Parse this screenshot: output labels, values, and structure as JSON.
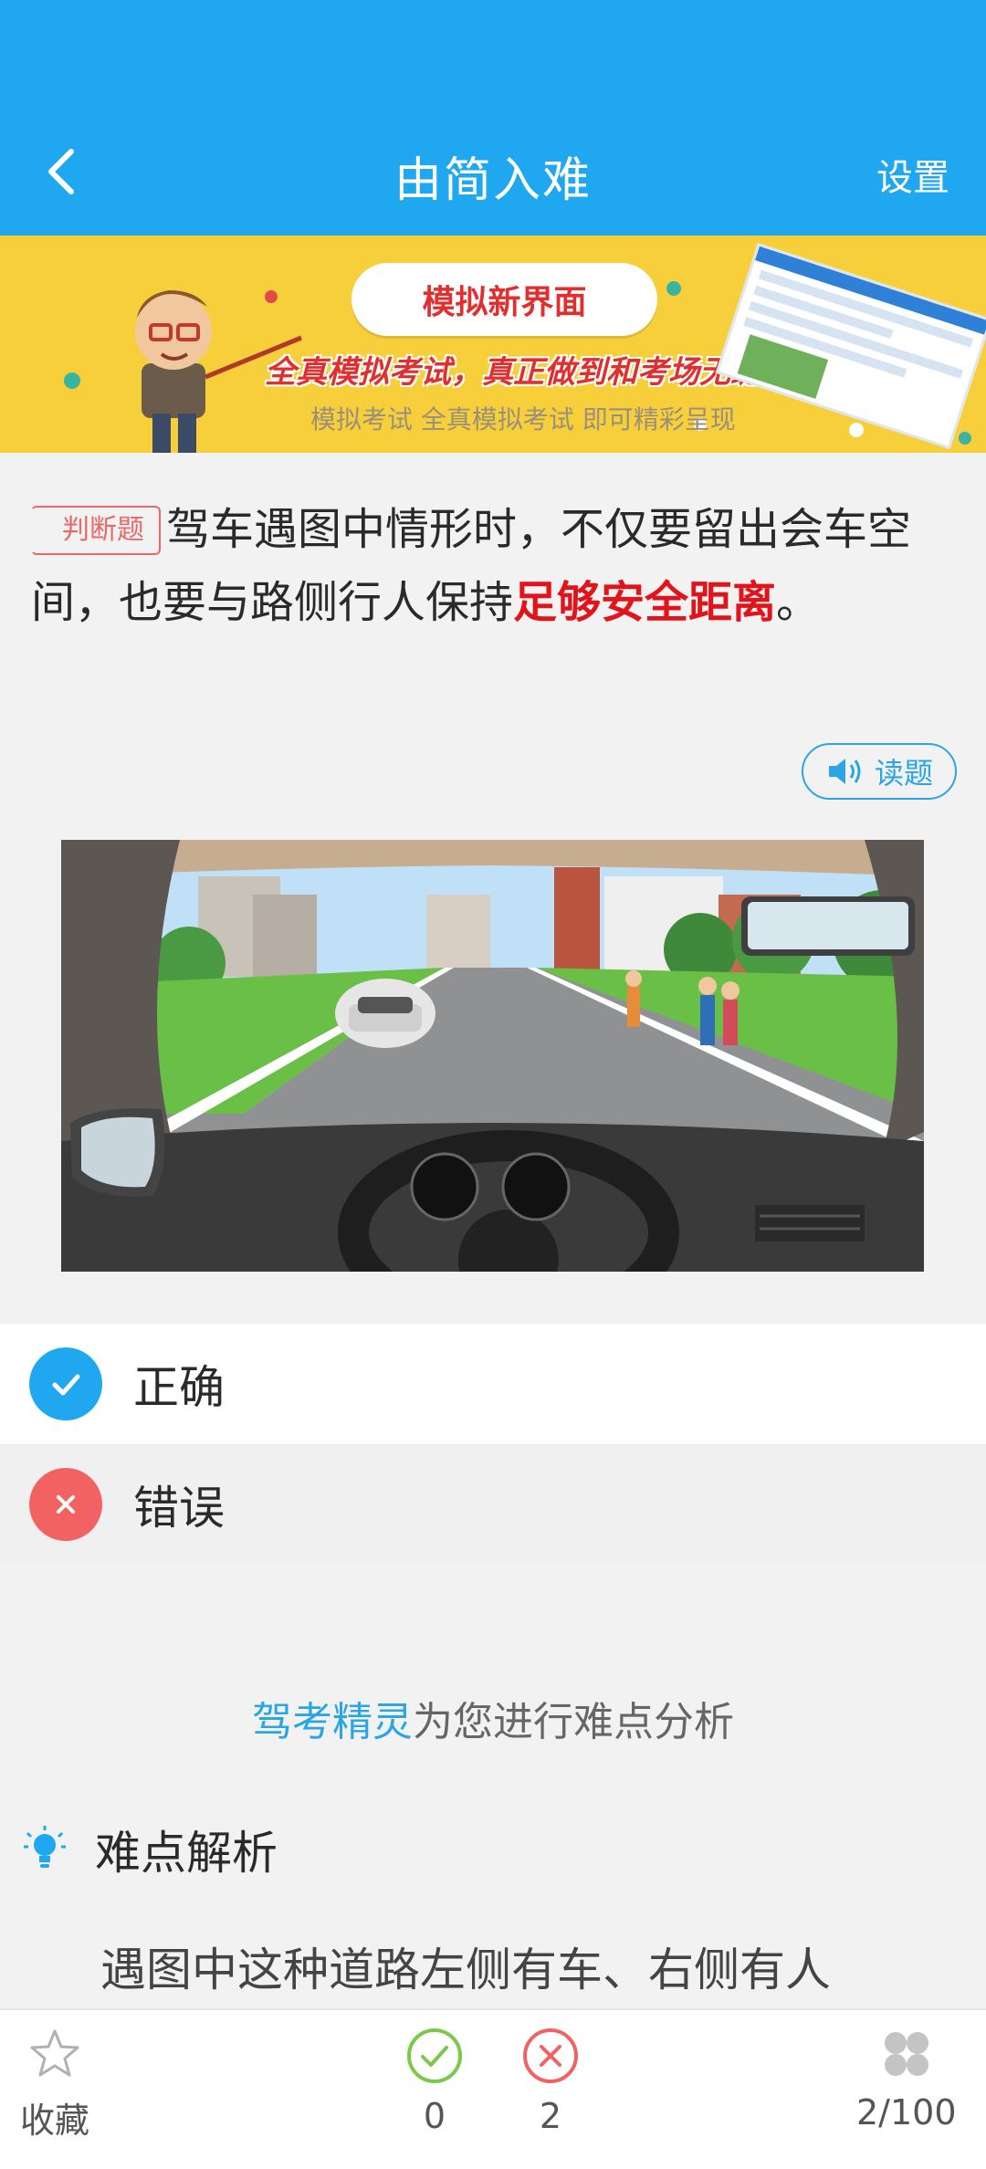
{
  "header": {
    "title": "由简入难",
    "settings_label": "设置"
  },
  "banner": {
    "headline": "模拟新界面",
    "slogan": "全真模拟考试，真正做到和考场无缝对接。",
    "subline": "模拟考试 全真模拟考试 即可精彩呈现"
  },
  "question": {
    "type_tag": "判断题",
    "text_before": "驾车遇图中情形时，不仅要留出会车空间，也要与路侧行人保持",
    "text_highlight": "足够安全距离",
    "text_after": "。",
    "read_label": "读题"
  },
  "options": [
    {
      "label": "正确",
      "color": "#1fa7f0",
      "state": "correct"
    },
    {
      "label": "错误",
      "color": "#f26262",
      "state": "wrong"
    }
  ],
  "analysis": {
    "brand": "驾考精灵",
    "tip_suffix": "为您进行难点分析",
    "section_title": "难点解析",
    "text": "遇图中这种道路左侧有车、右侧有人"
  },
  "bottom_bar": {
    "favorite_label": "收藏",
    "correct_count": "0",
    "wrong_count": "2",
    "progress": "2/100"
  },
  "colors": {
    "primary": "#1fa7f0",
    "danger": "#f26262",
    "correct_green": "#7cc84a"
  }
}
